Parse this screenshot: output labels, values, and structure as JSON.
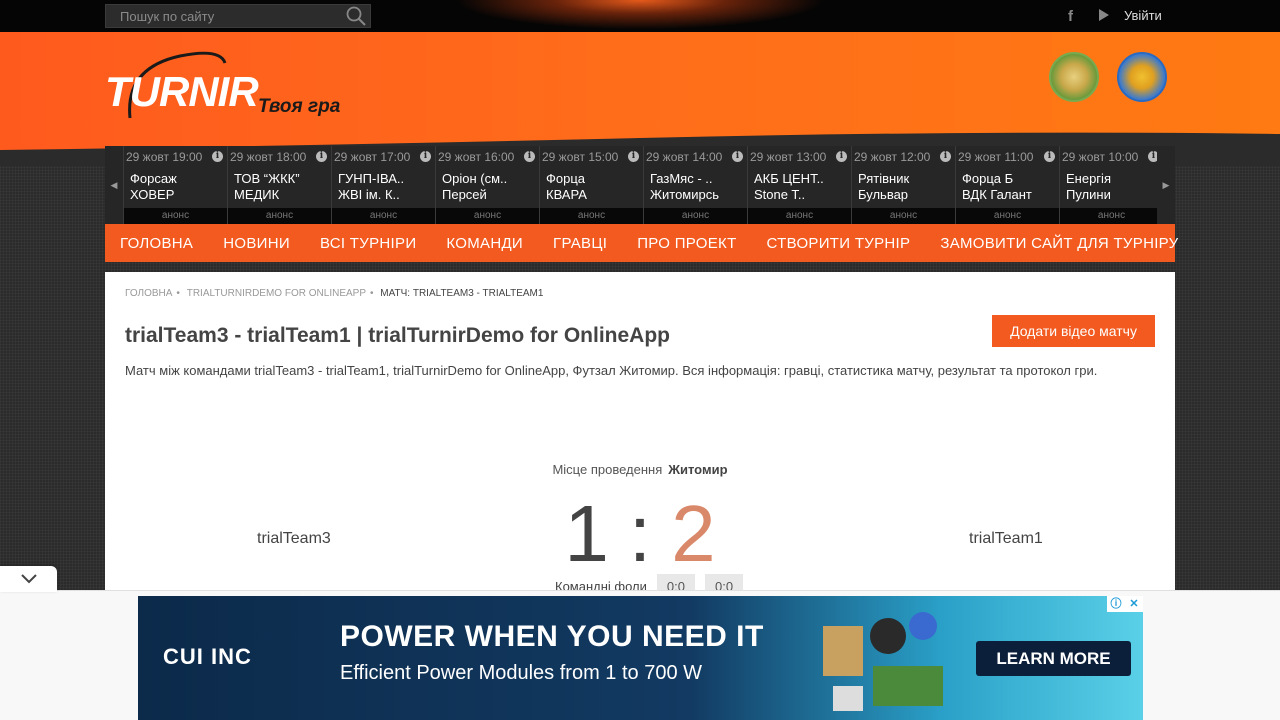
{
  "topbar": {
    "search_placeholder": "Пошук по сайту",
    "login_label": "Увійти"
  },
  "header": {
    "logo_text": "TURNIR",
    "tagline": "Твоя гра"
  },
  "ticker": {
    "matches": [
      {
        "date": "29 жовт 19:00",
        "team1": "Форсаж",
        "team2": "ХОВЕР",
        "status": "анонс"
      },
      {
        "date": "29 жовт 18:00",
        "team1": "ТОВ “ЖКК”",
        "team2": "МЕДИК",
        "status": "анонс"
      },
      {
        "date": "29 жовт 17:00",
        "team1": "ГУНП-ІВА..",
        "team2": "ЖВІ ім. К..",
        "status": "анонс"
      },
      {
        "date": "29 жовт 16:00",
        "team1": "Оріон (см..",
        "team2": "Персей",
        "status": "анонс"
      },
      {
        "date": "29 жовт 15:00",
        "team1": "Форца",
        "team2": "КВАРА",
        "status": "анонс"
      },
      {
        "date": "29 жовт 14:00",
        "team1": "ГазМяс - ..",
        "team2": "Житомирсь",
        "status": "анонс"
      },
      {
        "date": "29 жовт 13:00",
        "team1": "АКБ ЦЕНТ..",
        "team2": "Stone T..",
        "status": "анонс"
      },
      {
        "date": "29 жовт 12:00",
        "team1": "Рятівник",
        "team2": "Бульвар",
        "status": "анонс"
      },
      {
        "date": "29 жовт 11:00",
        "team1": "Форца Б",
        "team2": "ВДК Галант",
        "status": "анонс"
      },
      {
        "date": "29 жовт 10:00",
        "team1": "Енергія",
        "team2": "Пулини",
        "status": "анонс"
      }
    ]
  },
  "nav": {
    "items": [
      "Головна",
      "Новини",
      "Всі турніри",
      "Команди",
      "Гравці",
      "Про проект",
      "Створити турнір",
      "Замовити сайт для турніру"
    ]
  },
  "breadcrumb": {
    "home": "Головна",
    "tournament": "trialTurnirDemo for OnlineApp",
    "current": "Матч: trialTeam3 - trialTeam1"
  },
  "match": {
    "title": "trialTeam3 - trialTeam1 | trialTurnirDemo for OnlineApp",
    "add_video_label": "Додати відео матчу",
    "description": "Матч між командами trialTeam3 - trialTeam1, trialTurnirDemo for OnlineApp, Футзал Житомир. Вся інформація: гравці, статистика матчу, результат та протокол гри.",
    "venue_label": "Місце проведення",
    "venue": "Житомир",
    "home_team": "trialTeam3",
    "away_team": "trialTeam1",
    "home_score": "1",
    "separator": ":",
    "away_score": "2",
    "fouls_label": "Командні фоли",
    "home_fouls": "0:0",
    "away_fouls": "0:0"
  },
  "ad": {
    "brand": "CUI INC",
    "headline": "POWER WHEN YOU NEED IT",
    "subline": "Efficient Power Modules from 1 to 700 W",
    "cta": "LEARN MORE"
  },
  "colors": {
    "accent": "#f25a1f",
    "score_away": "#d9896a"
  }
}
